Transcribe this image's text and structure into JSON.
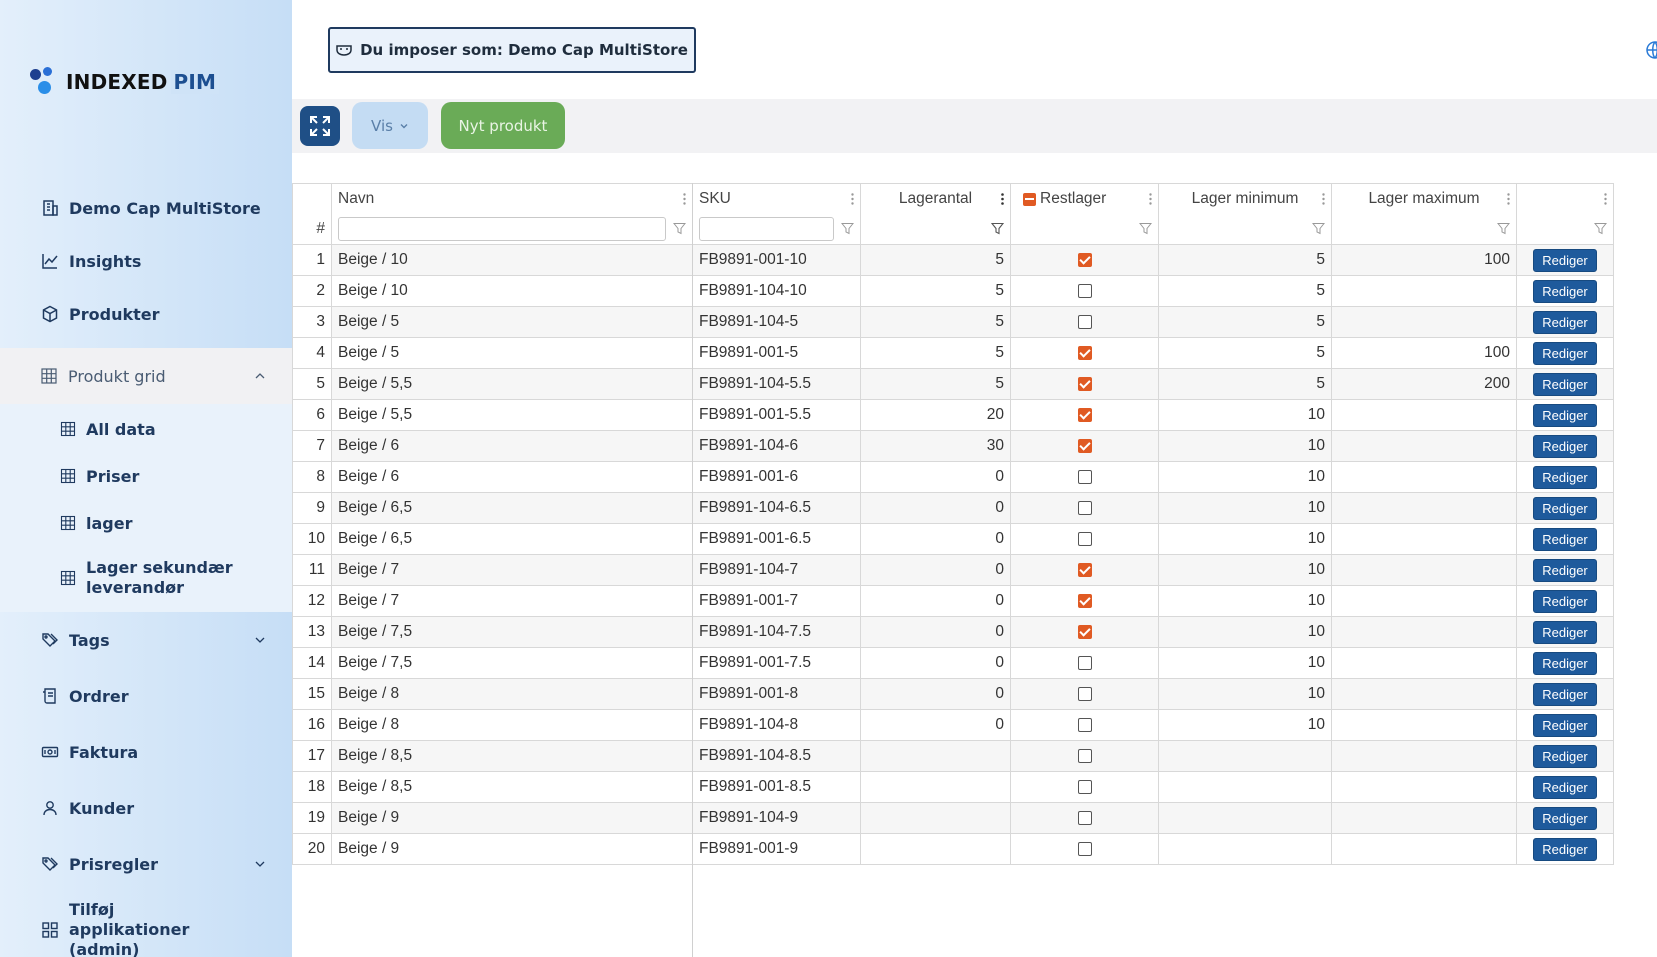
{
  "brand": {
    "name": "INDEXED",
    "suffix": "PIM"
  },
  "sidebar": {
    "items": [
      {
        "label": "Demo Cap MultiStore",
        "icon": "building-icon"
      },
      {
        "label": "Insights",
        "icon": "chart-line-icon"
      },
      {
        "label": "Produkter",
        "icon": "cube-icon"
      },
      {
        "label": "Produkt grid",
        "icon": "grid-icon",
        "expanded": true
      },
      {
        "label": "Tags",
        "icon": "tags-icon"
      },
      {
        "label": "Ordrer",
        "icon": "receipt-icon"
      },
      {
        "label": "Faktura",
        "icon": "money-icon"
      },
      {
        "label": "Kunder",
        "icon": "user-icon"
      },
      {
        "label": "Prisregler",
        "icon": "tags-icon"
      },
      {
        "label": "Tilføj applikationer (admin)",
        "icon": "apps-icon"
      }
    ],
    "subitems": [
      {
        "label": "All data"
      },
      {
        "label": "Priser"
      },
      {
        "label": "lager"
      },
      {
        "label": "Lager sekundær leverandør"
      }
    ]
  },
  "impose": {
    "label": "Du imposer som: Demo Cap MultiStore"
  },
  "toolbar": {
    "vis_label": "Vis",
    "new_label": "Nyt produkt"
  },
  "grid": {
    "columns": [
      "Navn",
      "SKU",
      "Lagerantal",
      "Restlager",
      "Lager minimum",
      "Lager maximum",
      ""
    ],
    "rownum_header": "#",
    "edit_label": "Rediger",
    "rows": [
      {
        "n": "1",
        "navn": "Beige / 10",
        "sku": "FB9891-001-10",
        "antal": "5",
        "rest": true,
        "min": "5",
        "max": "100"
      },
      {
        "n": "2",
        "navn": "Beige / 10",
        "sku": "FB9891-104-10",
        "antal": "5",
        "rest": false,
        "min": "5",
        "max": ""
      },
      {
        "n": "3",
        "navn": "Beige / 5",
        "sku": "FB9891-104-5",
        "antal": "5",
        "rest": false,
        "min": "5",
        "max": ""
      },
      {
        "n": "4",
        "navn": "Beige / 5",
        "sku": "FB9891-001-5",
        "antal": "5",
        "rest": true,
        "min": "5",
        "max": "100"
      },
      {
        "n": "5",
        "navn": "Beige / 5,5",
        "sku": "FB9891-104-5.5",
        "antal": "5",
        "rest": true,
        "min": "5",
        "max": "200"
      },
      {
        "n": "6",
        "navn": "Beige / 5,5",
        "sku": "FB9891-001-5.5",
        "antal": "20",
        "rest": true,
        "min": "10",
        "max": ""
      },
      {
        "n": "7",
        "navn": "Beige / 6",
        "sku": "FB9891-104-6",
        "antal": "30",
        "rest": true,
        "min": "10",
        "max": ""
      },
      {
        "n": "8",
        "navn": "Beige / 6",
        "sku": "FB9891-001-6",
        "antal": "0",
        "rest": false,
        "min": "10",
        "max": ""
      },
      {
        "n": "9",
        "navn": "Beige / 6,5",
        "sku": "FB9891-104-6.5",
        "antal": "0",
        "rest": false,
        "min": "10",
        "max": ""
      },
      {
        "n": "10",
        "navn": "Beige / 6,5",
        "sku": "FB9891-001-6.5",
        "antal": "0",
        "rest": false,
        "min": "10",
        "max": ""
      },
      {
        "n": "11",
        "navn": "Beige / 7",
        "sku": "FB9891-104-7",
        "antal": "0",
        "rest": true,
        "min": "10",
        "max": ""
      },
      {
        "n": "12",
        "navn": "Beige / 7",
        "sku": "FB9891-001-7",
        "antal": "0",
        "rest": true,
        "min": "10",
        "max": ""
      },
      {
        "n": "13",
        "navn": "Beige / 7,5",
        "sku": "FB9891-104-7.5",
        "antal": "0",
        "rest": true,
        "min": "10",
        "max": ""
      },
      {
        "n": "14",
        "navn": "Beige / 7,5",
        "sku": "FB9891-001-7.5",
        "antal": "0",
        "rest": false,
        "min": "10",
        "max": ""
      },
      {
        "n": "15",
        "navn": "Beige / 8",
        "sku": "FB9891-001-8",
        "antal": "0",
        "rest": false,
        "min": "10",
        "max": ""
      },
      {
        "n": "16",
        "navn": "Beige / 8",
        "sku": "FB9891-104-8",
        "antal": "0",
        "rest": false,
        "min": "10",
        "max": ""
      },
      {
        "n": "17",
        "navn": "Beige / 8,5",
        "sku": "FB9891-104-8.5",
        "antal": "",
        "rest": false,
        "min": "",
        "max": ""
      },
      {
        "n": "18",
        "navn": "Beige / 8,5",
        "sku": "FB9891-001-8.5",
        "antal": "",
        "rest": false,
        "min": "",
        "max": ""
      },
      {
        "n": "19",
        "navn": "Beige / 9",
        "sku": "FB9891-104-9",
        "antal": "",
        "rest": false,
        "min": "",
        "max": ""
      },
      {
        "n": "20",
        "navn": "Beige / 9",
        "sku": "FB9891-001-9",
        "antal": "",
        "rest": false,
        "min": "",
        "max": ""
      }
    ]
  },
  "colors": {
    "accent": "#1e5a9c",
    "checkbox": "#e05a23",
    "new_button": "#6aab57",
    "sidebar": "#c6def6"
  }
}
